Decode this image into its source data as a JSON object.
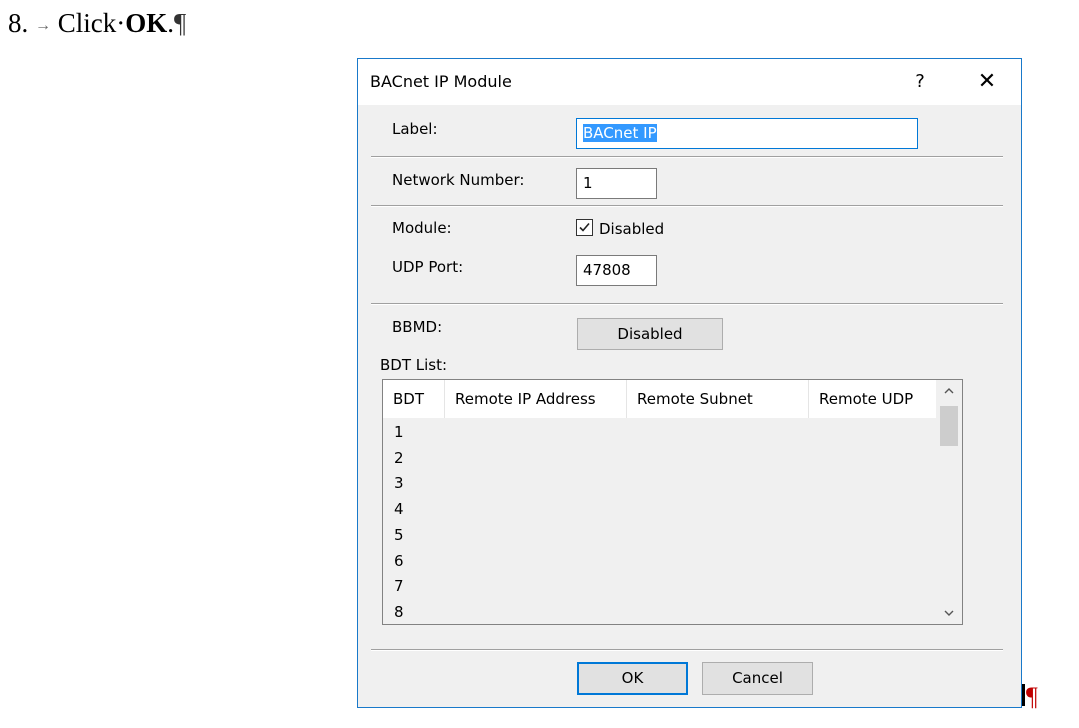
{
  "doc": {
    "step_number": "8.",
    "tab_mark": "→",
    "click_text": "Click·",
    "ok_text": "OK",
    "period": ".",
    "pilcrow": "¶",
    "end_pilcrow": "¶"
  },
  "dialog": {
    "title": "BACnet IP Module",
    "help": "?",
    "close": "✕",
    "label_caption": "Label:",
    "label_value": "BACnet IP",
    "network_caption": "Network Number:",
    "network_value": "1",
    "module_caption": "Module:",
    "module_checkbox_label": "Disabled",
    "module_checked": true,
    "udp_caption": "UDP Port:",
    "udp_value": "47808",
    "bbmd_caption": "BBMD:",
    "bbmd_button": "Disabled",
    "bdt_caption": "BDT List:",
    "bdt_columns": [
      "BDT",
      "Remote IP Address",
      "Remote Subnet",
      "Remote UDP"
    ],
    "bdt_rows": [
      "1",
      "2",
      "3",
      "4",
      "5",
      "6",
      "7",
      "8"
    ],
    "ok_button": "OK",
    "cancel_button": "Cancel"
  },
  "colors": {
    "accent": "#0078d7",
    "selection": "#3399ff",
    "dialog_bg": "#f0f0f0",
    "border": "#1979ca",
    "pilcrow_red": "#c00000"
  }
}
